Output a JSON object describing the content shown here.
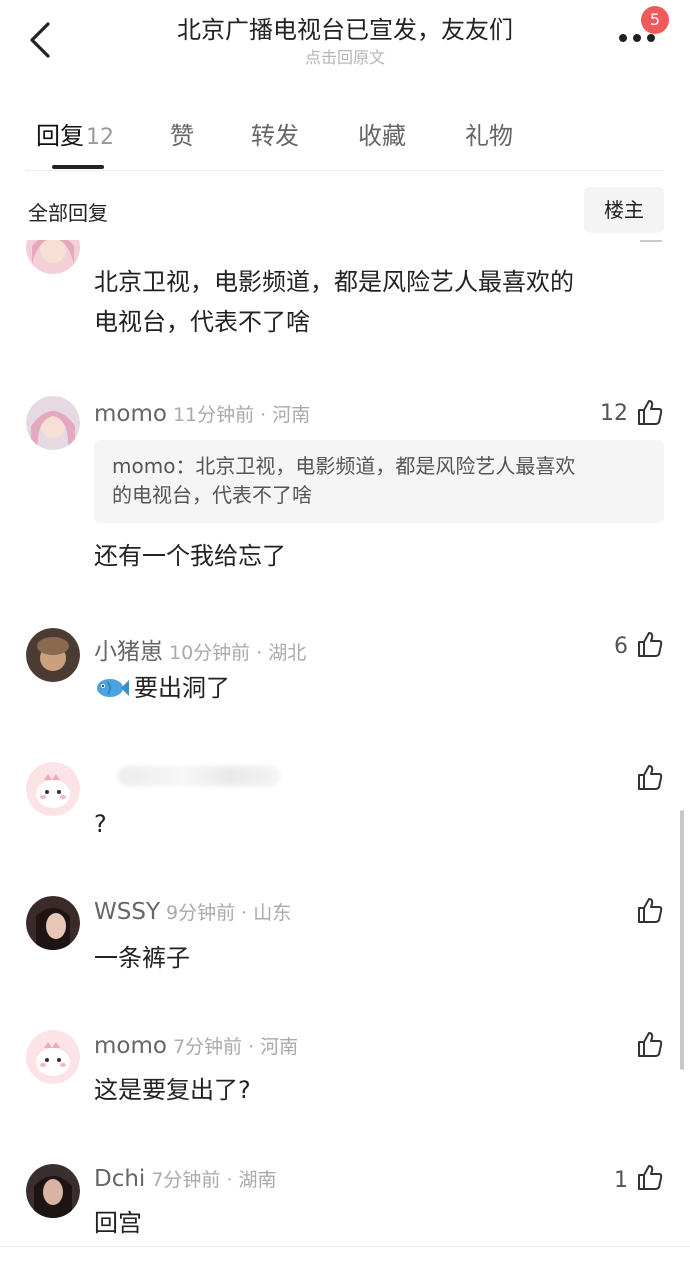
{
  "header": {
    "title": "北京广播电视台已宣发，友友们",
    "subtitle": "点击回原文",
    "badge_count": "5",
    "back_icon": "chevron-left-icon",
    "more_icon": "more-dots-icon"
  },
  "tabs": [
    {
      "label": "回复",
      "count": "12"
    },
    {
      "label": "赞"
    },
    {
      "label": "转发"
    },
    {
      "label": "收藏"
    },
    {
      "label": "礼物"
    }
  ],
  "section": {
    "label": "全部回复",
    "filter_button": "楼主"
  },
  "comments": [
    {
      "username": "",
      "meta": "",
      "text_lines": [
        "北京卫视，电影频道，都是风险艺人最喜欢的",
        "电视台，代表不了啥"
      ],
      "likes": ""
    },
    {
      "username": "momo",
      "meta": "11分钟前 · 河南",
      "quote_lines": [
        "momo：北京卫视，电影频道，都是风险艺人最喜欢",
        "的电视台，代表不了啥"
      ],
      "text": "还有一个我给忘了",
      "likes": "12"
    },
    {
      "username": "小猪崽",
      "meta": "10分钟前 · 湖北",
      "text": "要出洞了",
      "emoji": "fish-emoji",
      "likes": "6"
    },
    {
      "username": "",
      "meta": "",
      "text": "?",
      "likes": ""
    },
    {
      "username": "WSSY",
      "meta": "9分钟前 · 山东",
      "text": "一条裤子",
      "likes": ""
    },
    {
      "username": "momo",
      "meta": "7分钟前 · 河南",
      "text": "这是要复出了?",
      "likes": ""
    },
    {
      "username": "Dchi",
      "meta": "7分钟前 · 湖南",
      "text": "回宫",
      "likes": "1"
    }
  ],
  "colors": {
    "accent_badge": "#f25a5a",
    "text_primary": "#222222",
    "text_meta": "#aaaaaa",
    "quote_bg": "#f5f5f5"
  }
}
